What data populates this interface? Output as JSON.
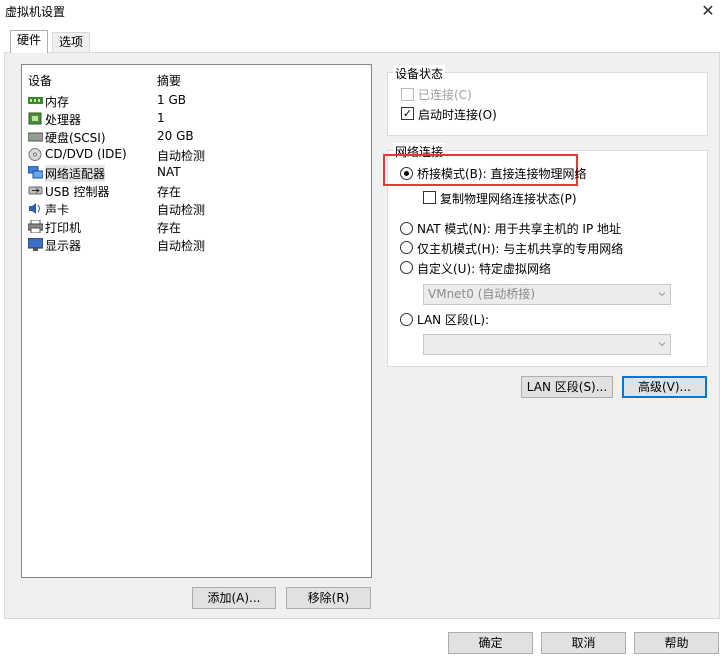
{
  "window": {
    "title": "虚拟机设置",
    "close_glyph": "✕"
  },
  "tabs": [
    {
      "label": "硬件",
      "active": true
    },
    {
      "label": "选项",
      "active": false
    }
  ],
  "device_list": {
    "headers": {
      "device": "设备",
      "summary": "摘要"
    },
    "rows": [
      {
        "name": "内存",
        "summary": "1 GB",
        "icon": "memory-icon"
      },
      {
        "name": "处理器",
        "summary": "1",
        "icon": "cpu-icon"
      },
      {
        "name": "硬盘(SCSI)",
        "summary": "20 GB",
        "icon": "harddisk-icon"
      },
      {
        "name": "CD/DVD (IDE)",
        "summary": "自动检测",
        "icon": "cdrom-icon"
      },
      {
        "name": "网络适配器",
        "summary": "NAT",
        "icon": "network-adapter-icon",
        "selected": true
      },
      {
        "name": "USB 控制器",
        "summary": "存在",
        "icon": "usb-icon"
      },
      {
        "name": "声卡",
        "summary": "自动检测",
        "icon": "sound-icon"
      },
      {
        "name": "打印机",
        "summary": "存在",
        "icon": "printer-icon"
      },
      {
        "name": "显示器",
        "summary": "自动检测",
        "icon": "monitor-icon"
      }
    ]
  },
  "buttons": {
    "add": "添加(A)...",
    "remove": "移除(R)",
    "lan_segment": "LAN 区段(S)...",
    "advanced": "高级(V)...",
    "ok": "确定",
    "cancel": "取消",
    "help": "帮助"
  },
  "device_status": {
    "label": "设备状态",
    "connected": {
      "label": "已连接(C)",
      "checked": false,
      "disabled": true
    },
    "connect_on_power": {
      "label": "启动时连接(O)",
      "checked": true
    }
  },
  "network_connection": {
    "label": "网络连接",
    "bridged": {
      "label": "桥接模式(B): 直接连接物理网络",
      "selected": true
    },
    "replicate": {
      "label": "复制物理网络连接状态(P)",
      "checked": false
    },
    "nat": {
      "label": "NAT 模式(N): 用于共享主机的 IP 地址",
      "selected": false
    },
    "host_only": {
      "label": "仅主机模式(H): 与主机共享的专用网络",
      "selected": false
    },
    "custom": {
      "label": "自定义(U): 特定虚拟网络",
      "selected": false,
      "combo_value": "VMnet0 (自动桥接)"
    },
    "lan_segment": {
      "label": "LAN 区段(L):",
      "selected": false,
      "combo_value": ""
    }
  },
  "colors": {
    "accent": "#0078d7",
    "highlight": "#e53935",
    "panel_bg": "#f0f0f0"
  }
}
